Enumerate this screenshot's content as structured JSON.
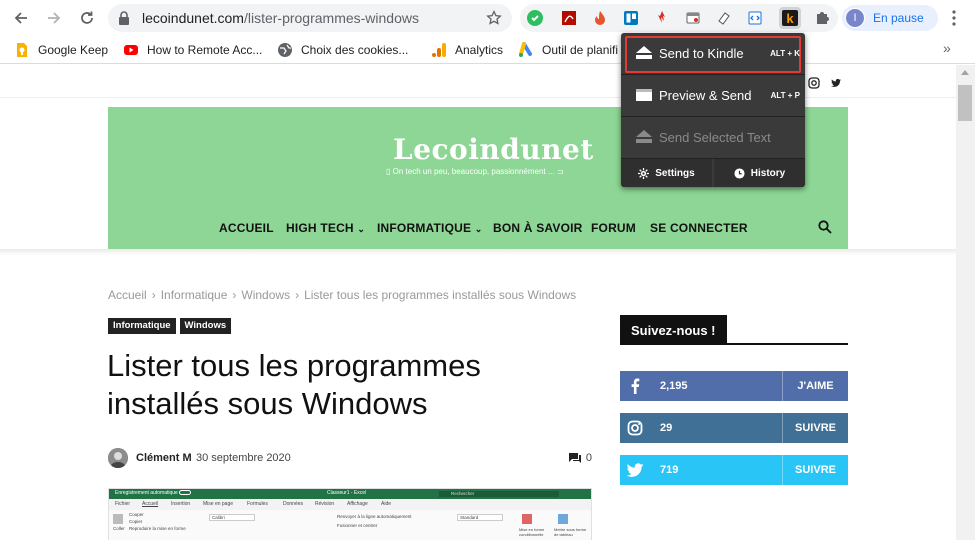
{
  "browser": {
    "url_domain": "lecoindunet.com",
    "url_path": "/lister-programmes-windows",
    "profile_initial": "I",
    "profile_status": "En pause"
  },
  "bookmarks": [
    {
      "label": "Google Keep",
      "icon": "google-keep-icon",
      "color": "#f6b400"
    },
    {
      "label": "How to Remote Acc...",
      "icon": "youtube-icon",
      "color": "#ff0000"
    },
    {
      "label": "Choix des cookies...",
      "icon": "globe-icon",
      "color": "#5f6368"
    },
    {
      "label": "Analytics",
      "icon": "analytics-icon",
      "color": "#f9ab00"
    },
    {
      "label": "Outil de planifi",
      "icon": "google-ads-icon",
      "color": "#4285f4"
    }
  ],
  "site": {
    "logo": "Lecoindunet",
    "tagline": "On tech un peu, beaucoup, passionnément ...",
    "menu": [
      "ACCUEIL",
      "HIGH TECH",
      "INFORMATIQUE",
      "BON À SAVOIR",
      "FORUM",
      "SE CONNECTER"
    ]
  },
  "article": {
    "breadcrumb": [
      "Accueil",
      "Informatique",
      "Windows",
      "Lister tous les programmes installés sous Windows"
    ],
    "tags": [
      "Informatique",
      "Windows"
    ],
    "title": "Lister tous les programmes installés sous Windows",
    "author": "Clément M",
    "date": "30 septembre 2020",
    "comments": "0"
  },
  "excel_preview": {
    "autosave": "Enregistrement automatique",
    "filename": "Classeur1 - Excel",
    "search": "Rechercher",
    "tabs": [
      "Fichier",
      "Accueil",
      "Insertion",
      "Mise en page",
      "Formules",
      "Données",
      "Révision",
      "Affichage",
      "Aide"
    ],
    "ribbon": [
      "Couper",
      "Copier",
      "Reproduire la mise en forme",
      "Coller",
      "Calibri",
      "Renvoyer à la ligne automatiquement",
      "Fusionner et centrer",
      "Standard",
      "Mise en forme conditionnelle",
      "Mettre sous forme de tableau"
    ]
  },
  "sidebar": {
    "heading": "Suivez-nous !",
    "social": [
      {
        "network": "facebook",
        "count": "2,195",
        "action": "J'AIME",
        "color": "#516eab"
      },
      {
        "network": "instagram",
        "count": "29",
        "action": "SUIVRE",
        "color": "#417096"
      },
      {
        "network": "twitter",
        "count": "719",
        "action": "SUIVRE",
        "color": "#29c5f6"
      }
    ]
  },
  "kindle_popup": {
    "send": {
      "label": "Send to Kindle",
      "shortcut": "ALT + K"
    },
    "preview": {
      "label": "Preview & Send",
      "shortcut": "ALT + P"
    },
    "selected": {
      "label": "Send Selected Text"
    },
    "settings": "Settings",
    "history": "History"
  }
}
